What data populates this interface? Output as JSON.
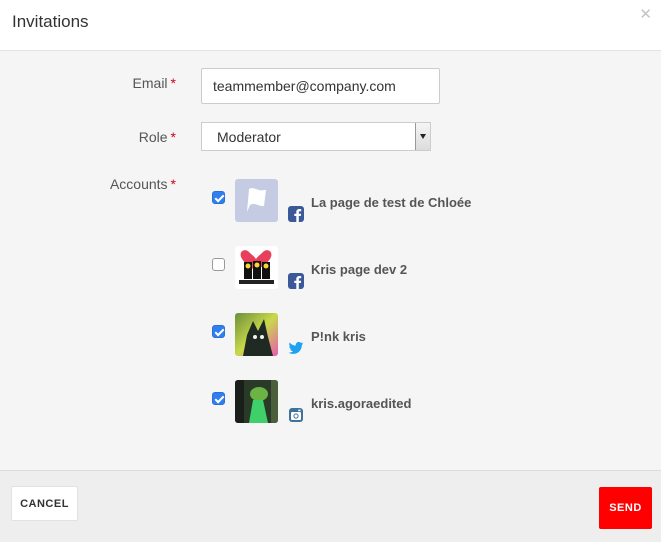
{
  "dialog": {
    "title": "Invitations",
    "close_icon": "close-icon"
  },
  "form": {
    "email": {
      "label": "Email",
      "required_mark": "*",
      "value": "teammember@company.com"
    },
    "role": {
      "label": "Role",
      "required_mark": "*",
      "value": "Moderator"
    },
    "accounts": {
      "label": "Accounts",
      "required_mark": "*",
      "items": [
        {
          "name": "La page de test de Chloée",
          "checked": true,
          "network": "facebook-icon"
        },
        {
          "name": "Kris page dev 2",
          "checked": false,
          "network": "facebook-icon"
        },
        {
          "name": "P!nk kris",
          "checked": true,
          "network": "twitter-icon"
        },
        {
          "name": "kris.agoraedited",
          "checked": true,
          "network": "instagram-icon"
        }
      ]
    }
  },
  "footer": {
    "cancel_label": "CANCEL",
    "send_label": "SEND"
  },
  "colors": {
    "accent_send": "#ff0000",
    "checkbox": "#2f7ff0",
    "required": "#d0021b",
    "facebook": "#3b5998",
    "twitter": "#1da1f2",
    "instagram": "#3f729b"
  }
}
